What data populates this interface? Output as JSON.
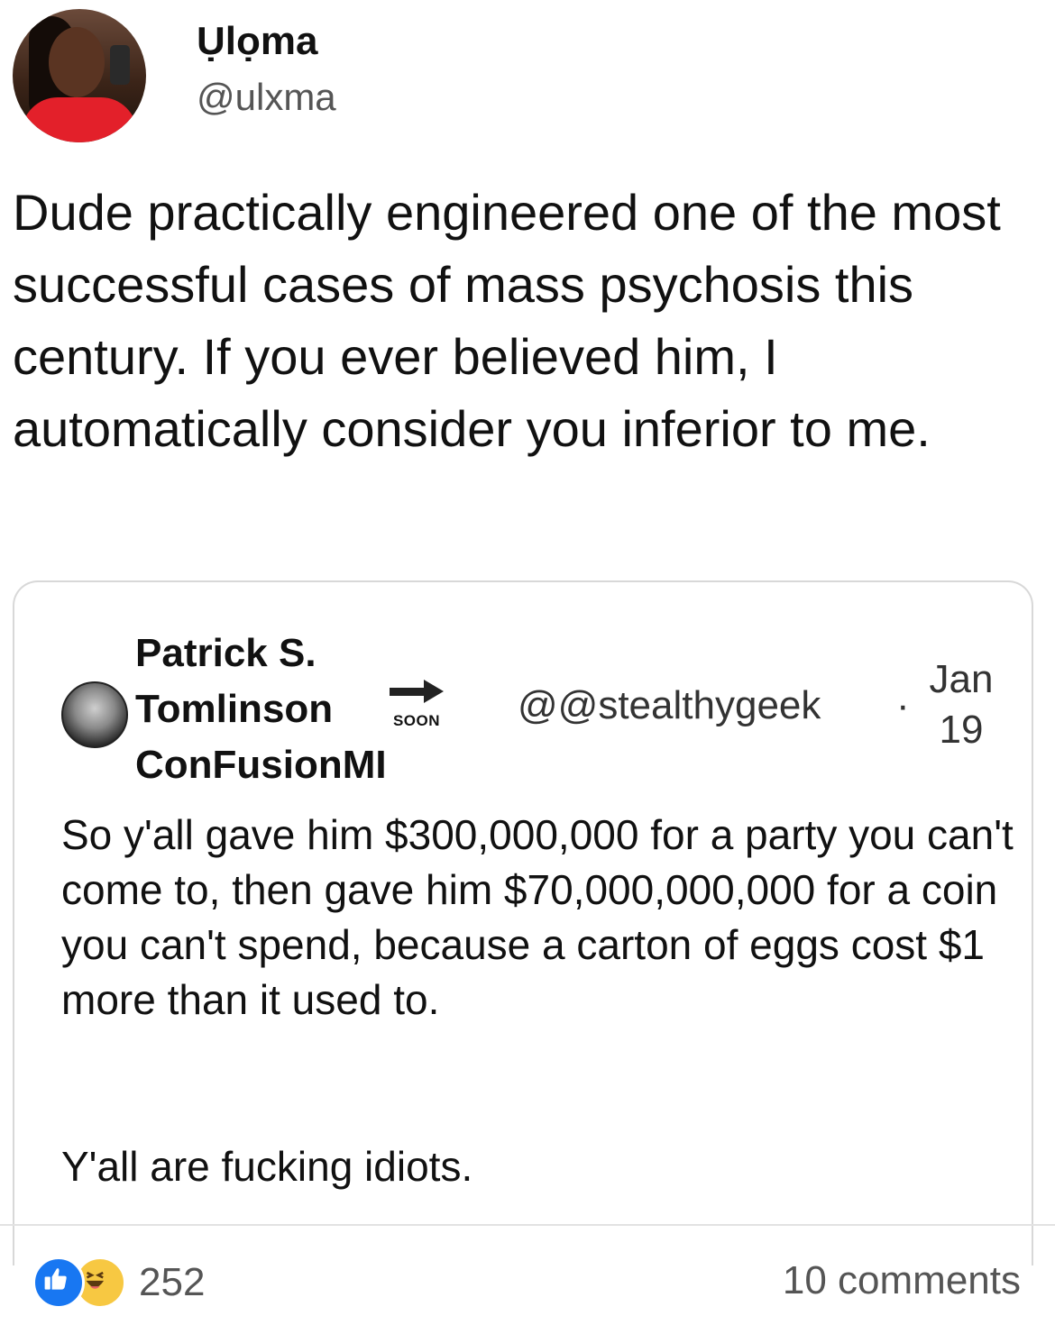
{
  "post": {
    "author": {
      "display_name": "Ụlọma",
      "handle": "@ulxma"
    },
    "text": "Dude practically engineered one of the most successful cases of mass psychosis this century. If you ever believed him, I automatically consider you inferior to me."
  },
  "quoted": {
    "name_line1": "Patrick S.",
    "name_line2": "Tomlinson",
    "name_line3": "ConFusionMI",
    "badge_label": "SOON",
    "handle": "@@stealthygeek",
    "separator": "·",
    "date_line1": "Jan",
    "date_line2": "19",
    "text": "So y'all gave him $300,000,000 for a party you can't come to, then gave him $70,000,000,000 for a coin you can't spend, because a carton of eggs cost $1 more than it used to.",
    "text2": "Y'all are fucking idiots."
  },
  "footer": {
    "reaction_count": "252",
    "comments": "10 comments"
  },
  "colors": {
    "like_blue": "#1877f2",
    "haha_yellow": "#f7c842",
    "muted_text": "#555555"
  },
  "icons": {
    "like": "like-icon",
    "haha": "haha-icon",
    "arrow": "arrow-right-icon"
  }
}
